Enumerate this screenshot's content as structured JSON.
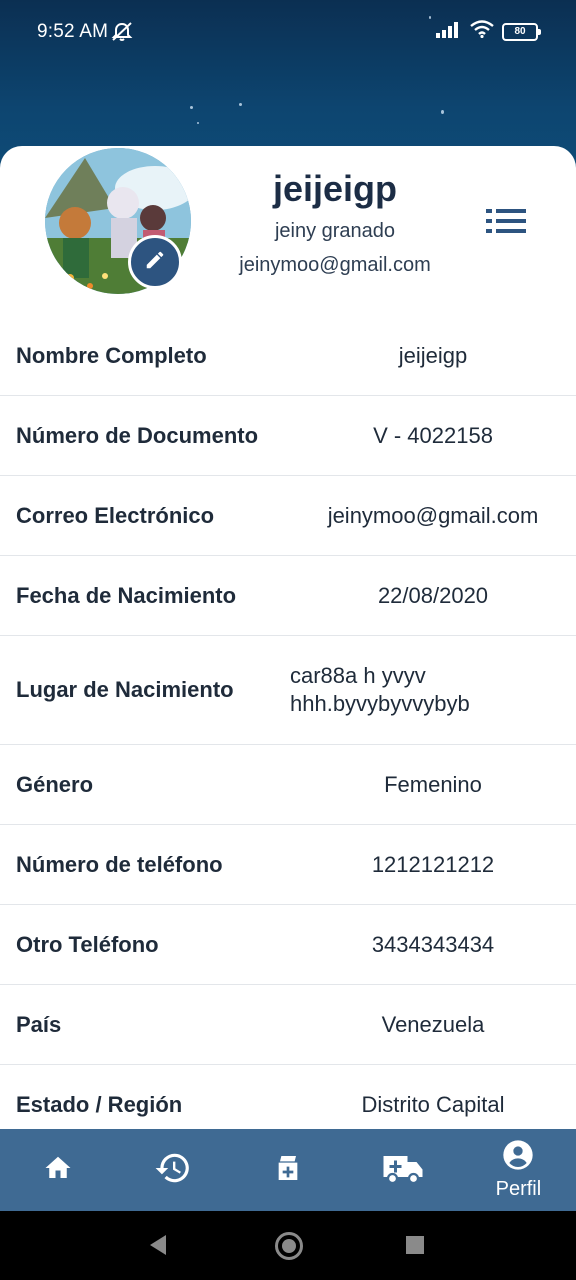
{
  "status": {
    "time": "9:52 AM",
    "battery": "80"
  },
  "profile": {
    "username": "jeijeigp",
    "full_name": "jeiny granado",
    "email": "jeinymoo@gmail.com"
  },
  "fields": [
    {
      "label": "Nombre Completo",
      "value": "jeijeigp"
    },
    {
      "label": "Número de Documento",
      "value": "V - 4022158"
    },
    {
      "label": "Correo Electrónico",
      "value": "jeinymoo@gmail.com"
    },
    {
      "label": "Fecha de Nacimiento",
      "value": "22/08/2020"
    },
    {
      "label": "Lugar de Nacimiento",
      "value": "car88a h yvyv hhh.byvybyvvybyb"
    },
    {
      "label": "Género",
      "value": "Femenino"
    },
    {
      "label": "Número de teléfono",
      "value": "1212121212"
    },
    {
      "label": "Otro Teléfono",
      "value": "3434343434"
    },
    {
      "label": "País",
      "value": "Venezuela"
    },
    {
      "label": "Estado / Región",
      "value": "Distrito Capital"
    }
  ],
  "nav": {
    "items": [
      {
        "icon": "home-icon"
      },
      {
        "icon": "history-icon"
      },
      {
        "icon": "medical-bag-icon"
      },
      {
        "icon": "ambulance-icon"
      },
      {
        "icon": "account-circle-icon",
        "label": "Perfil"
      }
    ]
  },
  "colors": {
    "accent": "#2d5480",
    "nav_bg": "#3f6a93",
    "header_bg": "#0d4570"
  }
}
